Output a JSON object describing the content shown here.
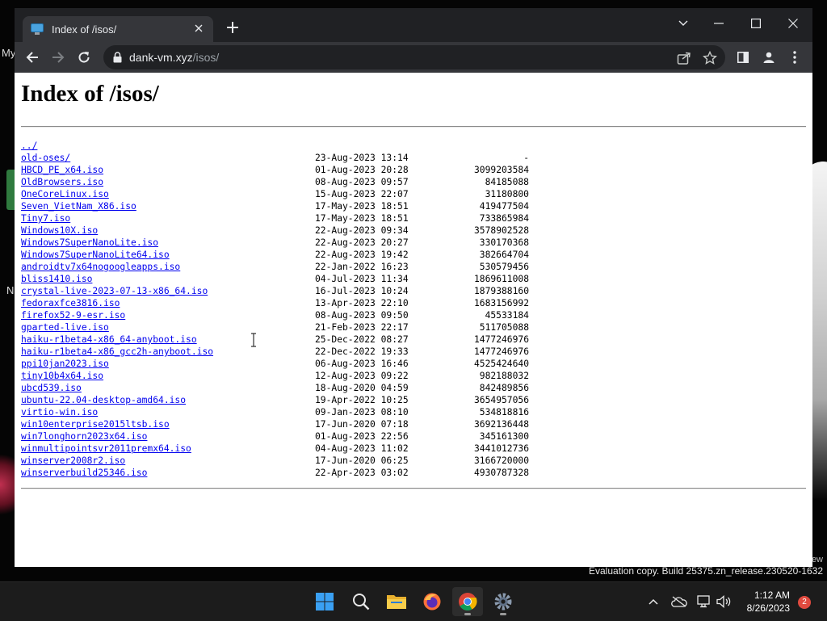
{
  "desktop": {
    "fragments": [
      "My",
      "N"
    ],
    "watermark_line1": "ew",
    "evaluation": "Evaluation copy. Build 25375.zn_release.230520-1632"
  },
  "browser": {
    "tab": {
      "title": "Index of /isos/",
      "favicon": "monitor-icon"
    },
    "address": {
      "domain": "dank-vm.xyz",
      "path": "/isos/"
    },
    "colors": {
      "frame": "#202124",
      "toolbar": "#35363a",
      "link": "#0000ee"
    }
  },
  "page": {
    "heading": "Index of /isos/",
    "parent_link": "../",
    "entries": [
      {
        "name": "old-oses/",
        "date": "23-Aug-2023 13:14",
        "size": "-"
      },
      {
        "name": "HBCD_PE_x64.iso",
        "date": "01-Aug-2023 20:28",
        "size": "3099203584"
      },
      {
        "name": "OldBrowsers.iso",
        "date": "08-Aug-2023 09:57",
        "size": "84185088"
      },
      {
        "name": "OneCoreLinux.iso",
        "date": "15-Aug-2023 22:07",
        "size": "31180800"
      },
      {
        "name": "Seven_VietNam_X86.iso",
        "date": "17-May-2023 18:51",
        "size": "419477504"
      },
      {
        "name": "Tiny7.iso",
        "date": "17-May-2023 18:51",
        "size": "733865984"
      },
      {
        "name": "Windows10X.iso",
        "date": "22-Aug-2023 09:34",
        "size": "3578902528"
      },
      {
        "name": "Windows7SuperNanoLite.iso",
        "date": "22-Aug-2023 20:27",
        "size": "330170368"
      },
      {
        "name": "Windows7SuperNanoLite64.iso",
        "date": "22-Aug-2023 19:42",
        "size": "382664704"
      },
      {
        "name": "androidtv7x64nogoogleapps.iso",
        "date": "22-Jan-2022 16:23",
        "size": "530579456"
      },
      {
        "name": "bliss1410.iso",
        "date": "04-Jul-2023 11:34",
        "size": "1869611008"
      },
      {
        "name": "crystal-live-2023-07-13-x86_64.iso",
        "date": "16-Jul-2023 10:24",
        "size": "1879388160"
      },
      {
        "name": "fedoraxfce3816.iso",
        "date": "13-Apr-2023 22:10",
        "size": "1683156992"
      },
      {
        "name": "firefox52-9-esr.iso",
        "date": "08-Aug-2023 09:50",
        "size": "45533184"
      },
      {
        "name": "gparted-live.iso",
        "date": "21-Feb-2023 22:17",
        "size": "511705088"
      },
      {
        "name": "haiku-r1beta4-x86_64-anyboot.iso",
        "date": "25-Dec-2022 08:27",
        "size": "1477246976"
      },
      {
        "name": "haiku-r1beta4-x86_gcc2h-anyboot.iso",
        "date": "22-Dec-2022 19:33",
        "size": "1477246976"
      },
      {
        "name": "ppi10jan2023.iso",
        "date": "06-Aug-2023 16:46",
        "size": "4525424640"
      },
      {
        "name": "tiny10b4x64.iso",
        "date": "12-Aug-2023 09:22",
        "size": "982188032"
      },
      {
        "name": "ubcd539.iso",
        "date": "18-Aug-2020 04:59",
        "size": "842489856"
      },
      {
        "name": "ubuntu-22.04-desktop-amd64.iso",
        "date": "19-Apr-2022 10:25",
        "size": "3654957056"
      },
      {
        "name": "virtio-win.iso",
        "date": "09-Jan-2023 08:10",
        "size": "534818816"
      },
      {
        "name": "win10enterprise2015ltsb.iso",
        "date": "17-Jun-2020 07:18",
        "size": "3692136448"
      },
      {
        "name": "win7longhorn2023x64.iso",
        "date": "01-Aug-2023 22:56",
        "size": "345161300"
      },
      {
        "name": "winmultipointsvr2011premx64.iso",
        "date": "04-Aug-2023 11:02",
        "size": "3441012736"
      },
      {
        "name": "winserver2008r2.iso",
        "date": "17-Jun-2020 06:25",
        "size": "3166720000"
      },
      {
        "name": "winserverbuild25346.iso",
        "date": "22-Apr-2023 03:02",
        "size": "4930787328"
      }
    ]
  },
  "taskbar": {
    "apps": [
      "start-icon",
      "search-icon",
      "file-explorer-icon",
      "firefox-icon",
      "chrome-icon",
      "settings-icon"
    ],
    "active_app": "chrome-icon",
    "clock": {
      "time": "1:12 AM",
      "date": "8/26/2023"
    },
    "notifications": "2"
  }
}
